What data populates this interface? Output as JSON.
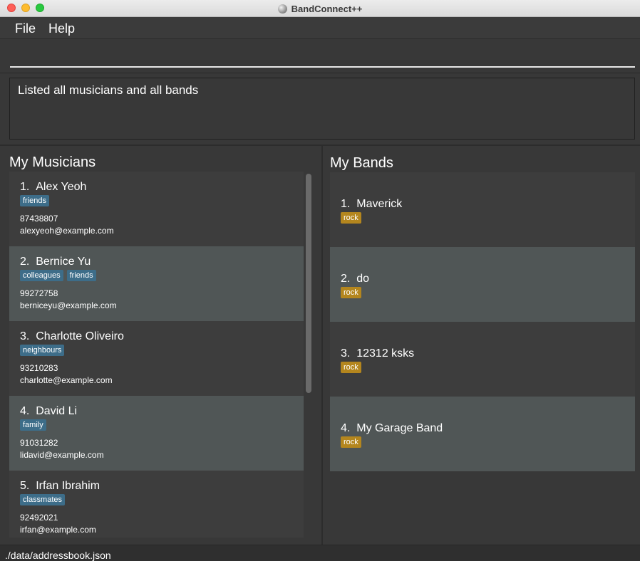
{
  "window": {
    "title": "BandConnect++"
  },
  "menu": {
    "file": "File",
    "help": "Help"
  },
  "command": {
    "value": ""
  },
  "result": {
    "text": "Listed all musicians and all bands"
  },
  "musicians": {
    "title": "My Musicians",
    "items": [
      {
        "index": "1.",
        "name": "Alex Yeoh",
        "tags": [
          "friends"
        ],
        "phone": "87438807",
        "email": "alexyeoh@example.com"
      },
      {
        "index": "2.",
        "name": "Bernice Yu",
        "tags": [
          "colleagues",
          "friends"
        ],
        "phone": "99272758",
        "email": "berniceyu@example.com"
      },
      {
        "index": "3.",
        "name": "Charlotte Oliveiro",
        "tags": [
          "neighbours"
        ],
        "phone": "93210283",
        "email": "charlotte@example.com"
      },
      {
        "index": "4.",
        "name": "David Li",
        "tags": [
          "family"
        ],
        "phone": "91031282",
        "email": "lidavid@example.com"
      },
      {
        "index": "5.",
        "name": "Irfan Ibrahim",
        "tags": [
          "classmates"
        ],
        "phone": "92492021",
        "email": "irfan@example.com"
      }
    ]
  },
  "bands": {
    "title": "My Bands",
    "items": [
      {
        "index": "1.",
        "name": "Maverick",
        "tags": [
          "rock"
        ]
      },
      {
        "index": "2.",
        "name": "do",
        "tags": [
          "rock"
        ]
      },
      {
        "index": "3.",
        "name": "12312 ksks",
        "tags": [
          "rock"
        ]
      },
      {
        "index": "4.",
        "name": "My Garage Band",
        "tags": [
          "rock"
        ]
      }
    ]
  },
  "status": {
    "path": "./data/addressbook.json"
  },
  "colors": {
    "musician_tag": "#3d6d89",
    "band_tag": "#b4861e",
    "card_alt": "#505656",
    "card": "#3d3d3d",
    "background": "#383838"
  }
}
